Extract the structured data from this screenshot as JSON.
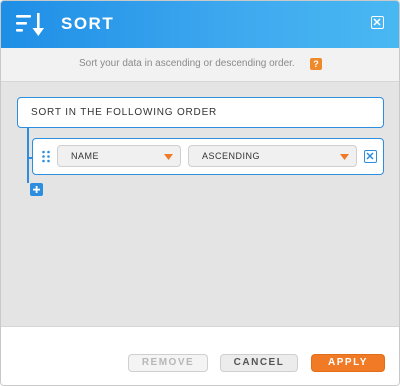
{
  "dialog": {
    "title": "SORT",
    "icon": "sort-descending-icon",
    "close_icon": "close-icon"
  },
  "subheader": {
    "text": "Sort your data in ascending or descending order.",
    "help_label": "?"
  },
  "sort_group": {
    "label": "SORT IN THE FOLLOWING ORDER",
    "rows": [
      {
        "field": "NAME",
        "direction": "ASCENDING"
      }
    ]
  },
  "footer": {
    "remove_label": "REMOVE",
    "cancel_label": "CANCEL",
    "apply_label": "APPLY"
  },
  "colors": {
    "header_blue": "#1e8ee6",
    "accent_blue": "#2d8ee0",
    "accent_orange": "#f07a25"
  }
}
